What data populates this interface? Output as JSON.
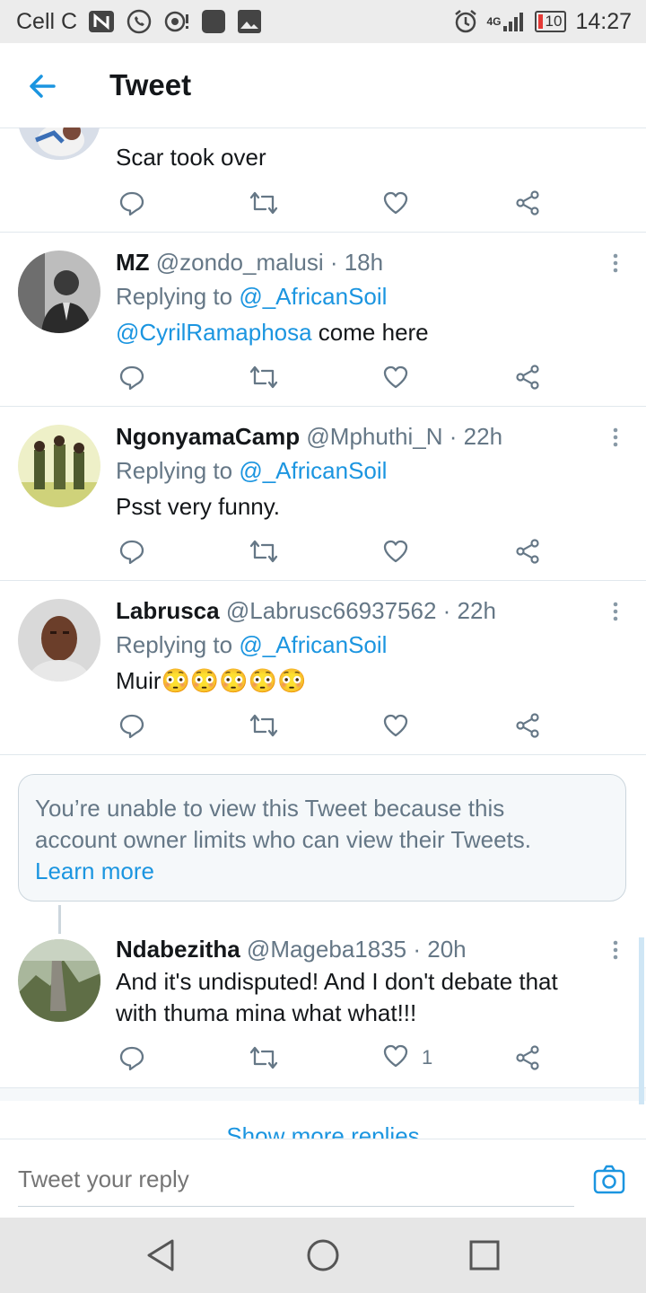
{
  "status_bar": {
    "carrier": "Cell C",
    "network": "4G",
    "battery": "10",
    "time": "14:27"
  },
  "header": {
    "title": "Tweet"
  },
  "tweets": [
    {
      "text": "Scar took over"
    },
    {
      "name": "MZ",
      "handle": "@zondo_malusi",
      "time": "· 18h",
      "replying_prefix": "Replying to",
      "replying_to": "@_AfricanSoil",
      "mention": "@CyrilRamaphosa",
      "text": " come here",
      "likes": ""
    },
    {
      "name": "NgonyamaCamp",
      "handle": "@Mphuthi_N",
      "time": "· 22h",
      "replying_prefix": "Replying to",
      "replying_to": "@_AfricanSoil",
      "text": "Psst very funny.",
      "likes": ""
    },
    {
      "name": "Labrusca",
      "handle": "@Labrusc66937562",
      "time": "· 22h",
      "replying_prefix": "Replying to",
      "replying_to": "@_AfricanSoil",
      "text": "Muir",
      "emojis": "😳😳😳😳😳",
      "likes": ""
    },
    {
      "name": "Ndabezitha",
      "handle": "@Mageba1835",
      "time": "· 20h",
      "text_line1": "And it's undisputed! And I don't debate that",
      "text_line2": "with thuma mina what what!!!",
      "likes": "1"
    }
  ],
  "notice": {
    "line1": "You’re unable to view this Tweet because this",
    "line2": "account owner limits who can view their Tweets.",
    "link": "Learn more"
  },
  "show_more": "Show more replies",
  "reply": {
    "placeholder": "Tweet your reply"
  },
  "colors": {
    "accent": "#1b95e0",
    "secondary": "#657786",
    "border": "#e1e8ed"
  }
}
